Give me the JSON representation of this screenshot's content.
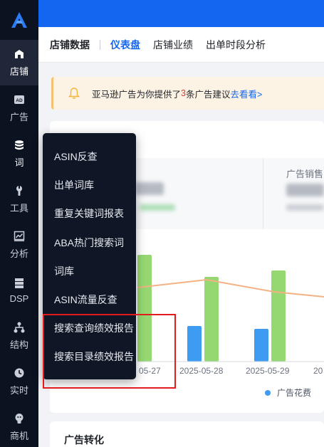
{
  "sidebar": {
    "logo": "logo-icon",
    "items": [
      {
        "label": "店铺",
        "icon": "store-icon",
        "active": true
      },
      {
        "label": "广告",
        "icon": "ad-icon",
        "badge": "AD"
      },
      {
        "label": "词",
        "icon": "database-icon"
      },
      {
        "label": "工具",
        "icon": "wrench-icon"
      },
      {
        "label": "分析",
        "icon": "chart-icon"
      },
      {
        "label": "DSP",
        "icon": "server-icon"
      },
      {
        "label": "结构",
        "icon": "hierarchy-icon"
      },
      {
        "label": "实时",
        "icon": "clock-icon"
      },
      {
        "label": "商机",
        "icon": "lightbulb-icon"
      }
    ]
  },
  "tabs": [
    {
      "label": "店铺数据"
    },
    {
      "label": "仪表盘"
    },
    {
      "label": "店铺业绩"
    },
    {
      "label": "出单时段分析"
    }
  ],
  "notice": {
    "prefix": "亚马逊广告为你提供了",
    "count": "3",
    "suffix": "条广告建议",
    "link": "去看看>"
  },
  "metrics": {
    "ad_sales_title": "广告销售"
  },
  "chart_data": {
    "type": "bar",
    "categories": [
      "05-27",
      "2025-05-28",
      "2025-05-29",
      "20"
    ],
    "legend": [
      {
        "name": "广告花费",
        "color": "#3d9bf2"
      }
    ],
    "colors": {
      "blue": "#3d9bf2",
      "green": "#95d872",
      "line": "#f4b183"
    }
  },
  "menu": {
    "items": [
      "ASIN反查",
      "出单词库",
      "重复关键词报表",
      "ABA热门搜索词",
      "词库",
      "ASIN流量反查",
      "搜索查询绩效报告",
      "搜索目录绩效报告"
    ]
  },
  "section": {
    "title": "广告转化"
  },
  "colors": {
    "brand": "#1466f0",
    "sidebar": "#0b1220",
    "highlight": "#e21c1c",
    "notice_bg": "#fdf3e4"
  }
}
